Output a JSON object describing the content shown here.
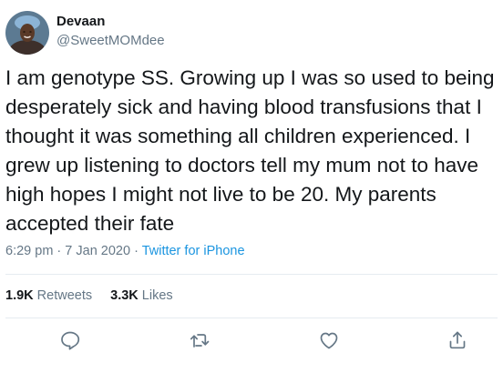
{
  "tweet": {
    "display_name": "Devaan",
    "handle": "@SweetMOMdee",
    "body_lines": [
      "I am genotype SS. Growing up I was so used to being",
      "desperately sick and having blood transfusions that I",
      "thought it was something all children experienced. I",
      "grew up listening to doctors tell my mum not to have",
      "high hopes I might not live to be 20. My parents",
      "accepted their fate"
    ],
    "time": "6:29 pm",
    "separator": " · ",
    "date": "7 Jan 2020",
    "source": "Twitter for iPhone",
    "retweets_count": "1.9K",
    "retweets_label": "Retweets",
    "likes_count": "3.3K",
    "likes_label": "Likes"
  },
  "icons": {
    "reply": "reply-icon",
    "retweet": "retweet-icon",
    "like": "heart-icon",
    "share": "share-icon"
  },
  "colors": {
    "text": "#14171a",
    "secondary": "#657786",
    "link": "#1b95e0",
    "divider": "#e6ecf0"
  }
}
